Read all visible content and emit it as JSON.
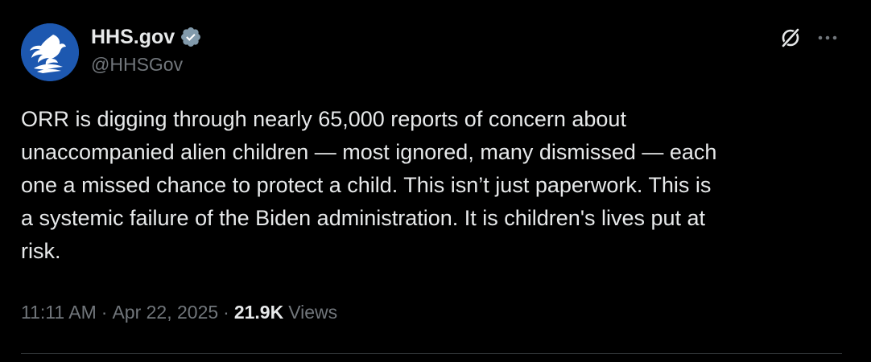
{
  "tweet": {
    "author": {
      "display_name": "HHS.gov",
      "handle": "@HHSGov",
      "verified": true,
      "avatar_icon": "hhs-eagle-logo-icon",
      "avatar_color": "#1d58b0",
      "badge_color": "#829aab"
    },
    "text": "ORR is digging through nearly 65,000 reports of concern about\nunaccompanied alien children — most ignored, many dismissed — each\none a missed chance to protect a child. This isn’t just paperwork. This is\na systemic failure of the Biden administration. It is children's lives put at\nrisk.",
    "meta": {
      "time": "11:11 AM",
      "separator": "·",
      "date": "Apr 22, 2025",
      "views_count": "21.9K",
      "views_label": "Views"
    },
    "actions": {
      "grok_icon": "grok-icon",
      "more_icon": "more-options-icon"
    }
  },
  "colors": {
    "background": "#000000",
    "primary_text": "#e7e9ea",
    "secondary_text": "#71767b",
    "divider": "#2f3336"
  }
}
